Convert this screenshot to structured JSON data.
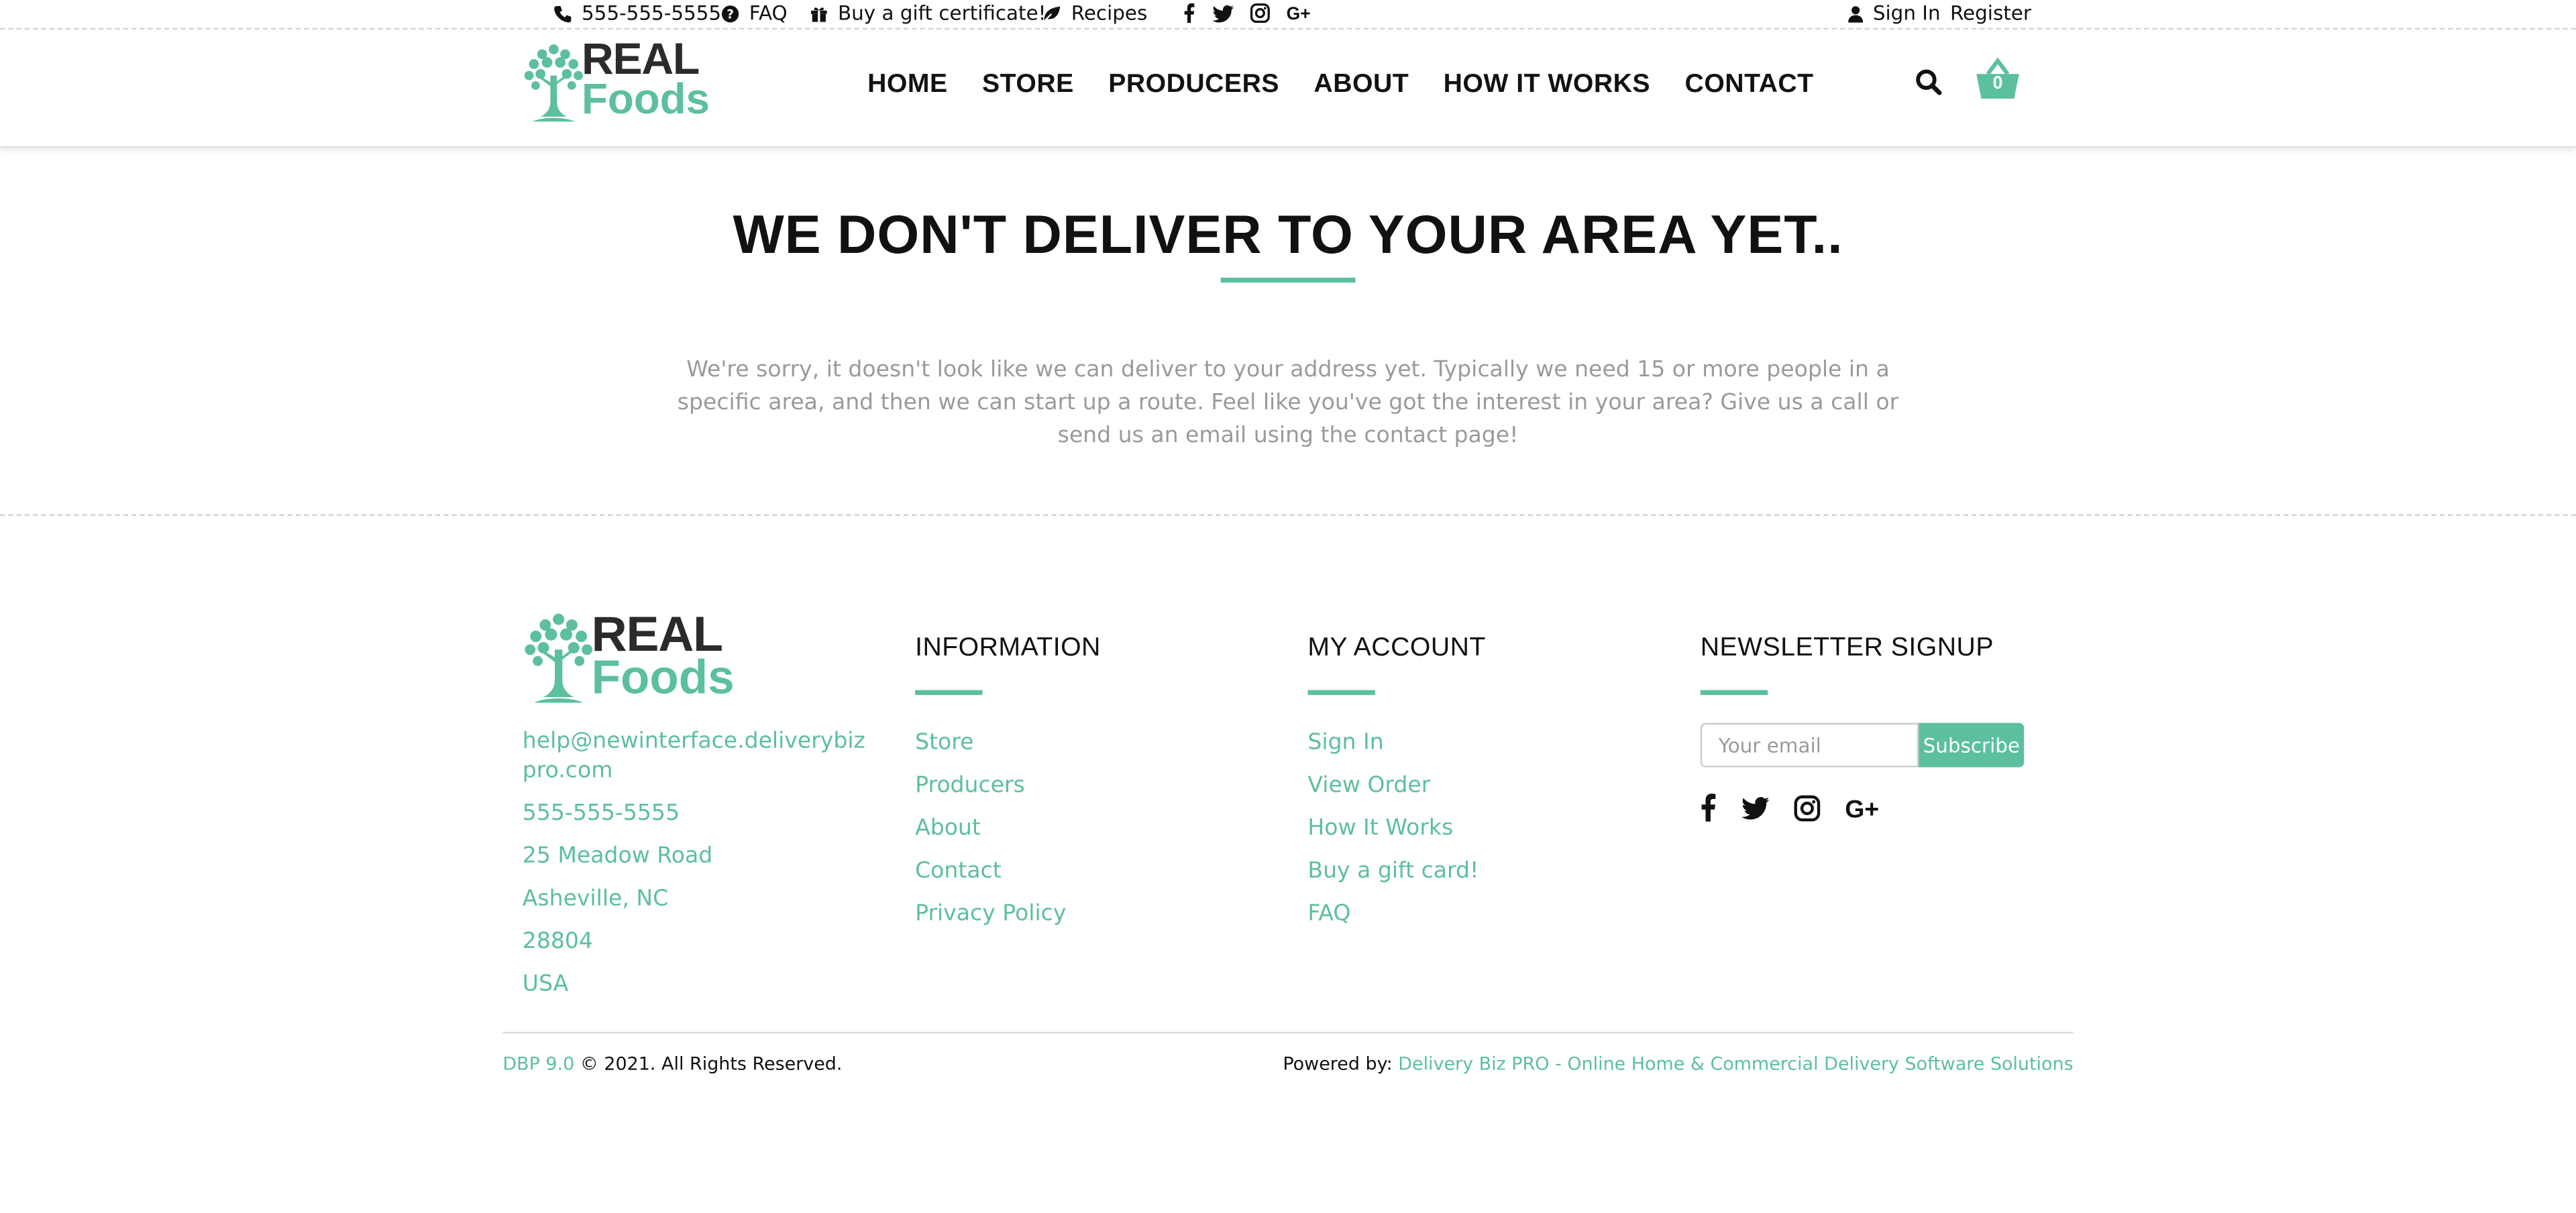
{
  "topbar": {
    "phone": "555-555-5555",
    "faq": "FAQ",
    "gift": "Buy a gift certificate!",
    "recipes": "Recipes",
    "sign_in": "Sign In",
    "register": "Register"
  },
  "logo": {
    "line1": "REAL",
    "line2": "Foods"
  },
  "nav": {
    "home": "HOME",
    "store": "STORE",
    "producers": "PRODUCERS",
    "about": "ABOUT",
    "how": "HOW IT WORKS",
    "contact": "CONTACT"
  },
  "cart": {
    "count": "0"
  },
  "hero": {
    "title": "WE DON'T DELIVER TO YOUR AREA YET..",
    "message": "We're sorry, it doesn't look like we can deliver to your address yet.  Typically we need 15 or more people in a specific area, and then we can start up a route.  Feel like you've got the interest in your area?  Give us a call or send us an email using the contact page!"
  },
  "footer": {
    "contact": {
      "email": "help@newinterface.deliverybizpro.com",
      "phone": "555-555-5555",
      "address": "25 Meadow Road",
      "city": "Asheville, NC",
      "zip": "28804",
      "country": "USA"
    },
    "information": {
      "heading": "INFORMATION",
      "links": [
        "Store",
        "Producers",
        "About",
        "Contact",
        "Privacy Policy"
      ]
    },
    "account": {
      "heading": "MY ACCOUNT",
      "links": [
        "Sign In",
        "View Order",
        "How It Works",
        "Buy a gift card!",
        "FAQ"
      ]
    },
    "newsletter": {
      "heading": "NEWSLETTER SIGNUP",
      "placeholder": "Your email",
      "button": "Subscribe"
    }
  },
  "bottom": {
    "version": "DBP 9.0",
    "copyright": "© 2021. All Rights Reserved.",
    "powered_label": "Powered by:",
    "powered_link": "Delivery Biz PRO - Online Home & Commercial Delivery Software Solutions"
  },
  "colors": {
    "accent": "#5cbf9f",
    "text": "#111111",
    "muted": "#9a9a9a"
  }
}
